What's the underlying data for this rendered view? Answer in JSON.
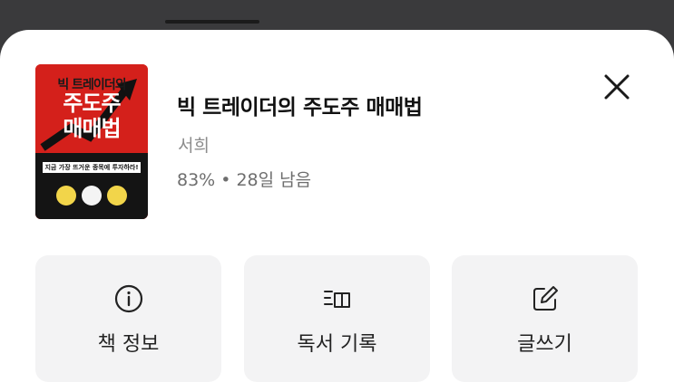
{
  "book": {
    "title": "빅 트레이더의 주도주 매매법",
    "author": "서희",
    "progress": "83%",
    "separator": "•",
    "remaining": "28일 남음",
    "cover": {
      "title_line1": "빅 트레이더의",
      "title_line2": "주도주",
      "title_line3": "매매법",
      "tagline": "지금 가장 뜨거운 종목에 투자하라!"
    }
  },
  "actions": [
    {
      "label": "책 정보",
      "icon": "info-icon"
    },
    {
      "label": "독서 기록",
      "icon": "reading-log-icon"
    },
    {
      "label": "글쓰기",
      "icon": "write-icon"
    }
  ],
  "colors": {
    "background_dim": "#3a3a3c",
    "sheet": "#ffffff",
    "card": "#f3f3f4",
    "cover_red": "#d4201b"
  }
}
